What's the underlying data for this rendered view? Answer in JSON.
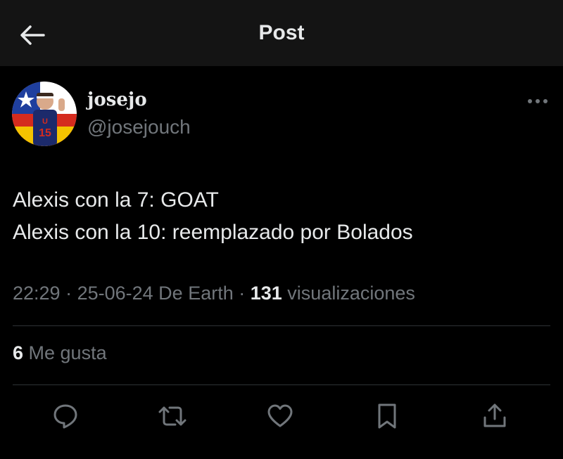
{
  "header": {
    "title": "Post",
    "back_icon": "arrow-left-icon"
  },
  "author": {
    "display_name": "josejo",
    "handle": "@josejouch",
    "avatar_jersey_number": "15"
  },
  "post": {
    "lines": [
      "Alexis con la 7: GOAT",
      "Alexis con la 10: reemplazado por Bolados"
    ]
  },
  "meta": {
    "time": "22:29",
    "sep1": " · ",
    "date": "25-06-24",
    "source": " De Earth",
    "sep2": " · ",
    "views_count": "131",
    "views_label": " visualizaciones"
  },
  "stats": {
    "likes_count": "6",
    "likes_label": " Me gusta"
  },
  "actions": {
    "icons": [
      "reply-icon",
      "repost-icon",
      "like-icon",
      "bookmark-icon",
      "share-icon"
    ]
  },
  "colors": {
    "background": "#000000",
    "header_background": "#141414",
    "text_primary": "#e7e9ea",
    "text_secondary": "#71767b",
    "divider": "#2f3336"
  }
}
